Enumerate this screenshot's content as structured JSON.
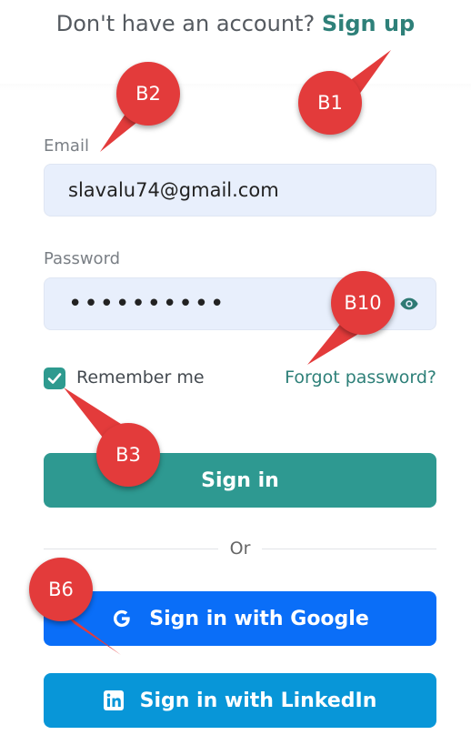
{
  "header": {
    "prompt": "Don't have an account?",
    "signup_label": "Sign up"
  },
  "form": {
    "email": {
      "label": "Email",
      "value": "slavalu74@gmail.com"
    },
    "password": {
      "label": "Password",
      "value": "••••••••••"
    },
    "remember_me": {
      "label": "Remember me",
      "checked": true
    },
    "forgot_password_label": "Forgot password?",
    "signin_label": "Sign in"
  },
  "divider": {
    "label": "Or"
  },
  "social": {
    "google_label": "Sign in with Google",
    "linkedin_label": "Sign in with LinkedIn"
  },
  "annotations": {
    "b1": "B1",
    "b2": "B2",
    "b3": "B3",
    "b6": "B6",
    "b10": "B10"
  },
  "colors": {
    "accent": "#2e8079",
    "primary_button": "#2e9991",
    "google_button": "#0a6ef8",
    "linkedin_button": "#0896d8",
    "input_bg": "#e8effc",
    "badge": "#e33b3b"
  }
}
